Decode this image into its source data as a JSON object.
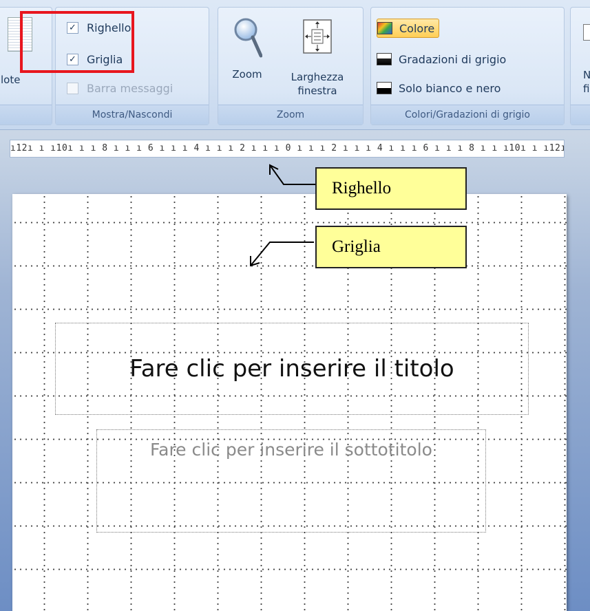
{
  "ribbon": {
    "partial_left_label": "lote",
    "show_hide": {
      "label": "Mostra/Nascondi",
      "ruler": {
        "label": "Righello",
        "checked": true
      },
      "grid": {
        "label": "Griglia",
        "checked": true
      },
      "message_bar": {
        "label": "Barra messaggi",
        "checked": false,
        "enabled": false
      }
    },
    "zoom": {
      "label": "Zoom",
      "zoom_button": "Zoom",
      "fit_window_line1": "Larghezza",
      "fit_window_line2": "finestra"
    },
    "color": {
      "label": "Colori/Gradazioni di grigio",
      "color_option": "Colore",
      "grayscale_option": "Gradazioni di grigio",
      "bw_option": "Solo bianco e nero",
      "selected": "Colore"
    },
    "partial_right_line1": "N",
    "partial_right_line2": "fi"
  },
  "ruler": {
    "text": "ı12ı ı ı10ı ı ı 8 ı ı ı 6 ı ı ı 4 ı ı ı 2 ı ı ı 0 ı ı ı 2 ı ı ı 4 ı ı ı 6 ı ı ı 8 ı ı ı10ı ı ı12ı"
  },
  "slide": {
    "title_placeholder": "Fare clic per inserire il titolo",
    "subtitle_placeholder": "Fare clic per inserire il sottotitolo"
  },
  "annotations": {
    "ruler_callout": "Righello",
    "grid_callout": "Griglia",
    "highlight_color": "#e8161e",
    "callout_fill": "#ffff99"
  }
}
